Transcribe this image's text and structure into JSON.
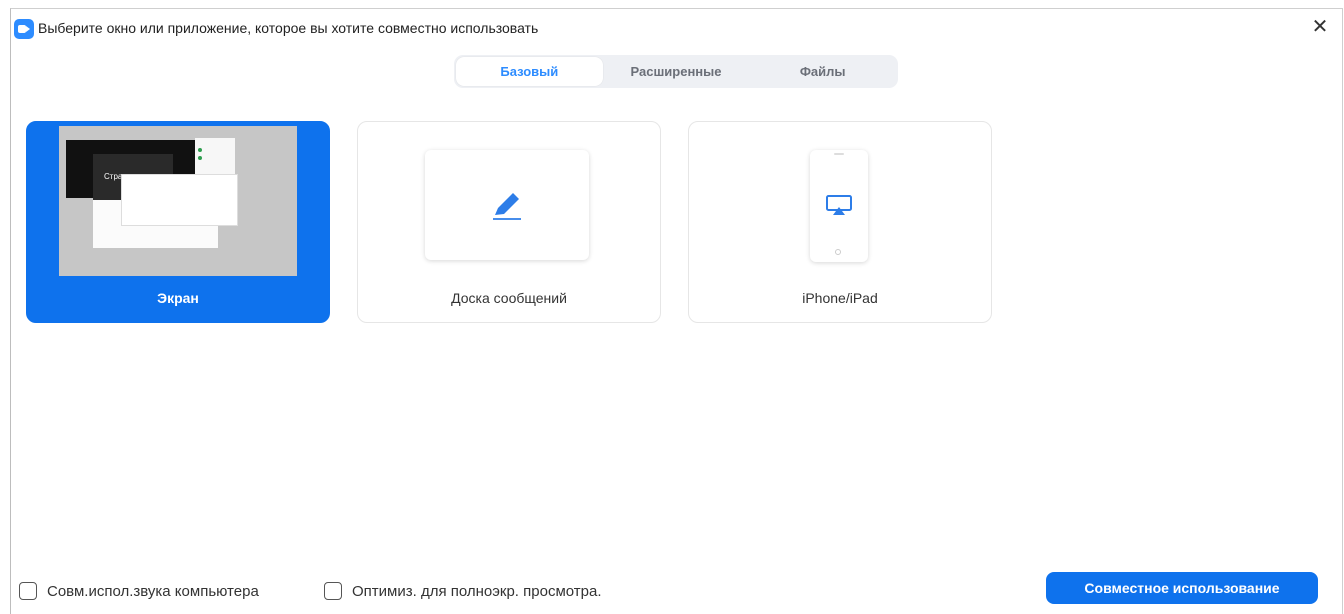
{
  "window": {
    "title": "Выберите окно или приложение, которое вы хотите совместно использовать",
    "close_glyph": "✕"
  },
  "tabs": [
    {
      "label": "Базовый",
      "active": true
    },
    {
      "label": "Расширенные",
      "active": false
    },
    {
      "label": "Файлы",
      "active": false
    }
  ],
  "cards": [
    {
      "label": "Экран",
      "selected": true,
      "icon": "screen-thumbnail"
    },
    {
      "label": "Доска сообщений",
      "selected": false,
      "icon": "pencil-icon"
    },
    {
      "label": "iPhone/iPad",
      "selected": false,
      "icon": "airplay-icon"
    }
  ],
  "thumbnail": {
    "partial_text": "Стра"
  },
  "footer": {
    "share_audio_label": "Совм.испол.звука компьютера",
    "share_audio_checked": false,
    "optimize_label": "Оптимиз. для полноэкр. просмотра.",
    "optimize_checked": false,
    "share_button_label": "Совместное использование"
  },
  "colors": {
    "accent": "#0e72ed",
    "tab_active_text": "#2d8cff",
    "tab_bar_bg": "#eef0f4"
  }
}
